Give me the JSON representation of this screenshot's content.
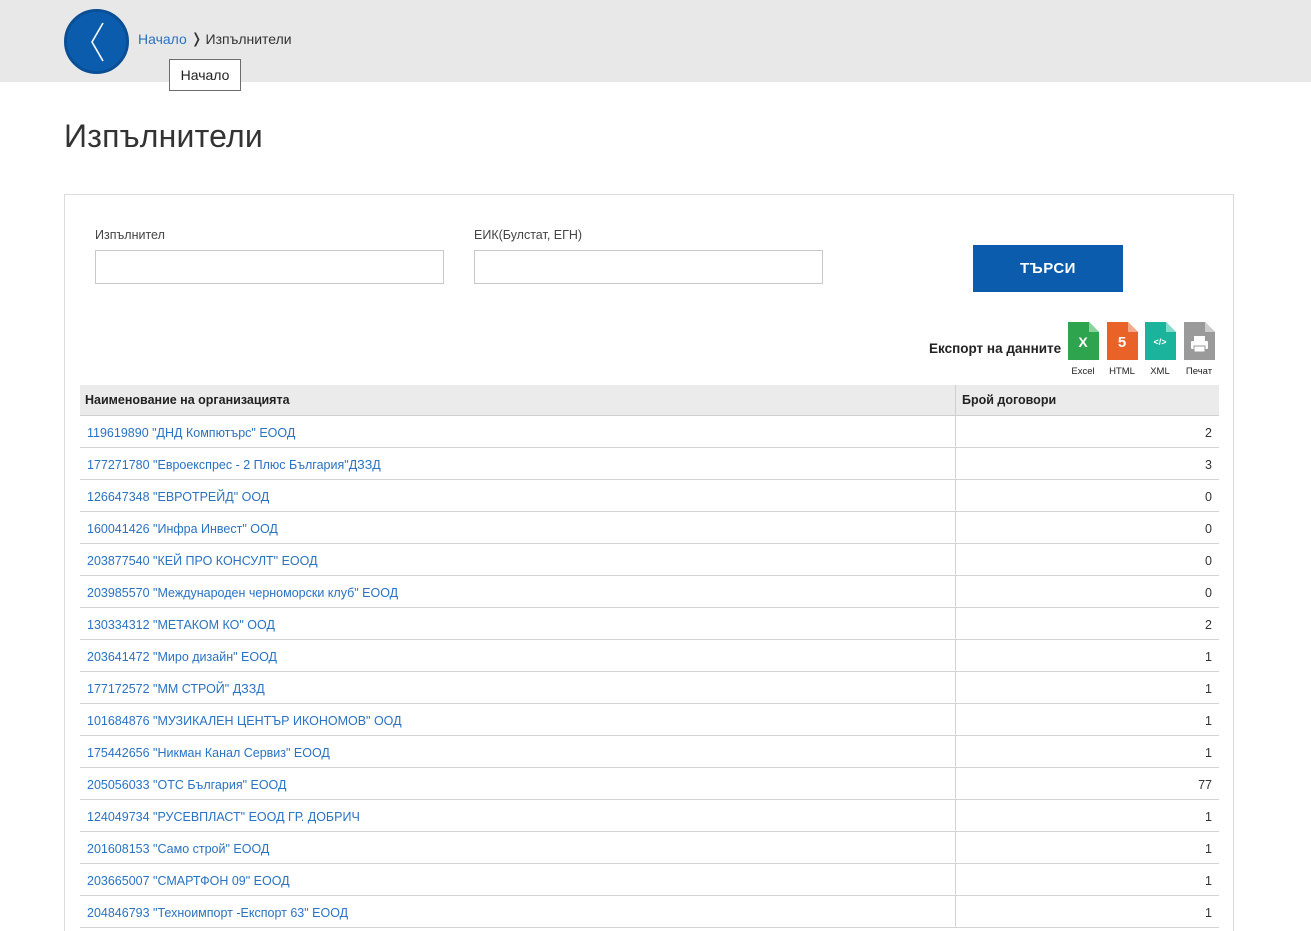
{
  "breadcrumb": {
    "home_label": "Начало",
    "separator": "❭",
    "current_label": "Изпълнители",
    "tooltip": "Начало"
  },
  "page": {
    "title": "Изпълнители"
  },
  "filters": {
    "contractor_label": "Изпълнител",
    "contractor_value": "",
    "eik_label": "ЕИК(Булстат, ЕГН)",
    "eik_value": "",
    "search_label": "ТЪРСИ"
  },
  "export": {
    "label": "Експорт на данните",
    "items": [
      {
        "caption": "Excel",
        "glyph": "X",
        "color": "#2ea44f",
        "icon": "excel-file-icon"
      },
      {
        "caption": "HTML",
        "glyph": "5",
        "color": "#e96228",
        "icon": "html-file-icon"
      },
      {
        "caption": "XML",
        "glyph": "</>",
        "color": "#1bb39b",
        "icon": "xml-file-icon"
      },
      {
        "caption": "Печат",
        "glyph": "",
        "color": "#9a9a9a",
        "icon": "print-file-icon"
      }
    ]
  },
  "table": {
    "headers": {
      "name": "Наименование на организацията",
      "count": "Брой договори"
    },
    "rows": [
      {
        "name": "119619890 \"ДНД Компютърс\" ЕООД",
        "count": "2"
      },
      {
        "name": "177271780 \"Евроекспрес - 2 Плюс България\"ДЗЗД",
        "count": "3"
      },
      {
        "name": "126647348 \"ЕВРОТРЕЙД\" ООД",
        "count": "0"
      },
      {
        "name": "160041426 \"Инфра Инвест\" ООД",
        "count": "0"
      },
      {
        "name": "203877540 \"КЕЙ ПРО КОНСУЛТ\" ЕООД",
        "count": "0"
      },
      {
        "name": "203985570 \"Международен черноморски клуб\" ЕООД",
        "count": "0"
      },
      {
        "name": "130334312 \"МЕТАКОМ КО\" ООД",
        "count": "2"
      },
      {
        "name": "203641472 \"Миро дизайн\" ЕООД",
        "count": "1"
      },
      {
        "name": "177172572 \"ММ СТРОЙ\" ДЗЗД",
        "count": "1"
      },
      {
        "name": "101684876 \"МУЗИКАЛЕН ЦЕНТЪР ИКОНОМОВ\" ООД",
        "count": "1"
      },
      {
        "name": "175442656 \"Никман Канал Сервиз\" ЕООД",
        "count": "1"
      },
      {
        "name": "205056033 \"ОТС България\" ЕООД",
        "count": "77"
      },
      {
        "name": "124049734 \"РУСЕВПЛАСТ\" ЕООД ГР. ДОБРИЧ",
        "count": "1"
      },
      {
        "name": "201608153 \"Само строй\" ЕООД",
        "count": "1"
      },
      {
        "name": "203665007 \"СМАРТФОН 09\" ЕООД",
        "count": "1"
      },
      {
        "name": "204846793 \"Техноимпорт -Експорт 63\" ЕООД",
        "count": "1"
      }
    ]
  }
}
